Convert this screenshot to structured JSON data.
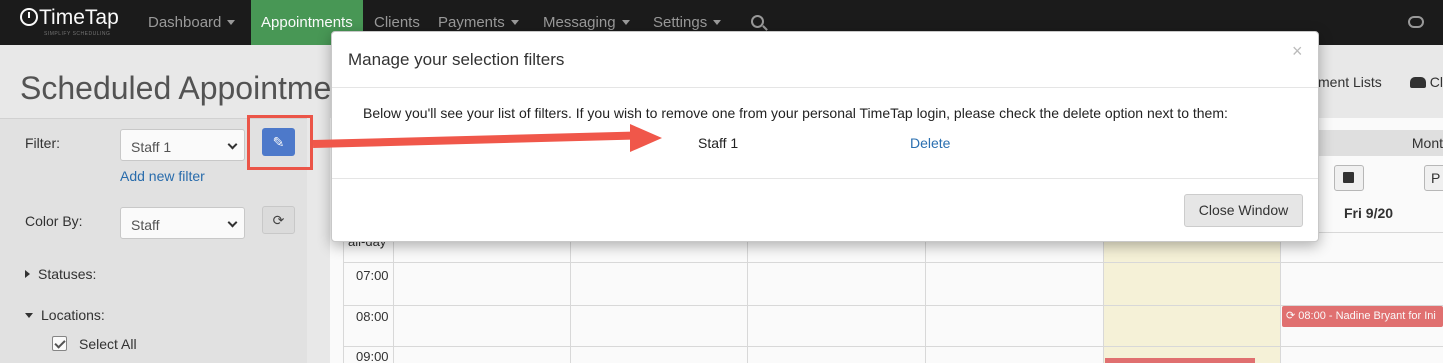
{
  "app": {
    "logo_text": "TimeTap",
    "logo_tagline": "SIMPLIFY SCHEDULING"
  },
  "nav": {
    "items": [
      {
        "label": "Dashboard"
      },
      {
        "label": "Appointments"
      },
      {
        "label": "Clients"
      },
      {
        "label": "Payments"
      },
      {
        "label": "Messaging"
      },
      {
        "label": "Settings"
      }
    ]
  },
  "page": {
    "title": "Scheduled Appointments"
  },
  "sidebar": {
    "filter_label": "Filter:",
    "filter_value": "Staff 1",
    "add_filter_link": "Add new filter",
    "color_by_label": "Color By:",
    "color_by_value": "Staff",
    "statuses_label": "Statuses:",
    "locations_label": "Locations:",
    "select_all_label": "Select All"
  },
  "toolbar": {
    "appointment_lists": "ment Lists",
    "classes": "Clas"
  },
  "calendar": {
    "view_month": "Mont",
    "p_button": "P",
    "day_header": "Fri 9/20",
    "allday_label": "all-day",
    "times": [
      "07:00",
      "08:00",
      "09:00"
    ],
    "appointment_label": "08:00 - Nadine Bryant for Ini"
  },
  "modal": {
    "title": "Manage your selection filters",
    "close_glyph": "×",
    "instructions": "Below you'll see your list of filters. If you wish to remove one from your personal TimeTap login, please check the delete option next to them:",
    "filters": [
      {
        "name": "Staff 1",
        "action": "Delete"
      }
    ],
    "close_button": "Close Window"
  },
  "colors": {
    "nav_bg": "#1c1c1c",
    "nav_active": "#4a9b57",
    "edit_button": "#4f7ccf",
    "annotation_red": "#f0574a",
    "link_blue": "#2a6fb0",
    "appointment_red": "#e57373"
  }
}
